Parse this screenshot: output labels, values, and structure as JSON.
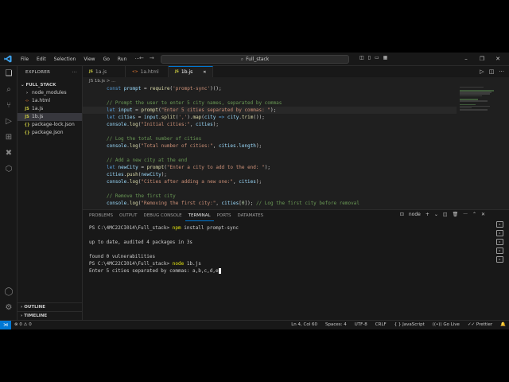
{
  "window": {
    "menu": [
      "File",
      "Edit",
      "Selection",
      "View",
      "Go",
      "Run"
    ],
    "search_text": "Full_stack",
    "more_menu": "···"
  },
  "explorer": {
    "title": "EXPLORER",
    "more": "···",
    "folder": "FULL_STACK",
    "items": [
      {
        "label": "node_modules",
        "type": "folder"
      },
      {
        "label": "1a.html",
        "type": "html"
      },
      {
        "label": "1a.js",
        "type": "js"
      },
      {
        "label": "1b.js",
        "type": "js",
        "selected": true
      },
      {
        "label": "package-lock.json",
        "type": "json"
      },
      {
        "label": "package.json",
        "type": "json"
      }
    ],
    "outline": "OUTLINE",
    "timeline": "TIMELINE"
  },
  "tabs": [
    {
      "label": "1a.js",
      "icon": "JS",
      "active": false
    },
    {
      "label": "1a.html",
      "icon": "<>",
      "active": false
    },
    {
      "label": "1b.js",
      "icon": "JS",
      "active": true
    }
  ],
  "breadcrumb": "JS 1b.js > ...",
  "code": [
    "const prompt = require('prompt-sync')();",
    "",
    "// Prompt the user to enter 5 city names, separated by commas",
    "let input = prompt(\"Enter 5 cities separated by commas: \");",
    "let cities = input.split(',').map(city => city.trim());",
    "console.log(\"Initial cities:\", cities);",
    "",
    "// Log the total number of cities",
    "console.log(\"Total number of cities:\", cities.length);",
    "",
    "// Add a new city at the end",
    "let newCity = prompt(\"Enter a city to add to the end: \");",
    "cities.push(newCity);",
    "console.log(\"Cities after adding a new one:\", cities);",
    "",
    "// Remove the first city",
    "console.log(\"Removing the first city:\", cities[0]); // Log the first city before removal"
  ],
  "panel": {
    "tabs": [
      "PROBLEMS",
      "OUTPUT",
      "DEBUG CONSOLE",
      "TERMINAL",
      "PORTS",
      "DATAMATES"
    ],
    "active_tab": "TERMINAL",
    "shell": "node",
    "terminal": {
      "line1_prompt": "PS C:\\4MC22CI014\\Full_stack> ",
      "line1_cmd": "npm",
      "line1_rest": " install prompt-sync",
      "line3": "up to date, audited 4 packages in 3s",
      "line5": "found 0 vulnerabilities",
      "line6_prompt": "PS C:\\4MC22CI014\\Full_stack> ",
      "line6_cmd": "node",
      "line6_rest": " 1b.js",
      "line7": "Enter 5 cities separated by commas: a,b,c,d,e"
    }
  },
  "status": {
    "errors": "0",
    "warnings": "0",
    "position": "Ln 4, Col 60",
    "spaces": "Spaces: 4",
    "encoding": "UTF-8",
    "eol": "CRLF",
    "language": "JavaScript",
    "golive": "Go Live",
    "prettier": "Prettier"
  }
}
